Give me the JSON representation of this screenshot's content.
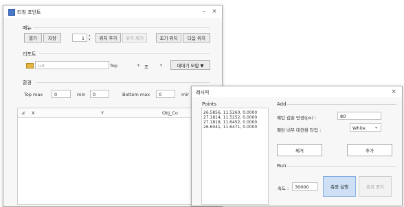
{
  "main": {
    "title": "티칭 포인트",
    "minimize": "–",
    "close": "×",
    "menu": {
      "heading": "메뉴",
      "open": "열기",
      "save": "저장",
      "index": "1",
      "add_pos": "위치 추가",
      "del_pos": "위치 제거",
      "init_pos": "초기 위치",
      "next_pos": "다음 위치"
    },
    "recipe": {
      "heading": "리포트",
      "lot_placeholder": "Lot",
      "top": "Top",
      "combo2": "조",
      "combo2_arrow": "▾",
      "top_arrow": "▾",
      "merge_button": "대대기 모합 ▼"
    },
    "env": {
      "heading": "환경",
      "top_max_label": "Top max",
      "top_max": "0",
      "min_label": "min",
      "min": "0",
      "bottom_max_label": "Bottom max",
      "bottom_max": "0",
      "min2_label": "mir"
    },
    "table": {
      "columns": [
        "X",
        "Y",
        "Obj_Co"
      ]
    }
  },
  "dialog": {
    "title": "레시피",
    "close": "×",
    "points": {
      "heading": "Points",
      "items": [
        "26.5856, 11.5260, 0.0000",
        "27.1814, 11.5252, 0.0000",
        "27.1818, 11.6452, 0.0000",
        "26.6041, 11.6471, 0.0000"
      ]
    },
    "add": {
      "heading": "Add",
      "radius_label": "패턴 검출 반경(px) :",
      "radius_value": "80",
      "type_label": "패턴 내부 대전환 타입 :",
      "type_value": "White",
      "type_arrow": "▾",
      "remove": "제거",
      "add_btn": "추가"
    },
    "run": {
      "heading": "Run",
      "speed_label": "속도 :",
      "speed_value": "30000",
      "run_btn": "측정 실행",
      "stop_btn": "측정 중지"
    }
  }
}
